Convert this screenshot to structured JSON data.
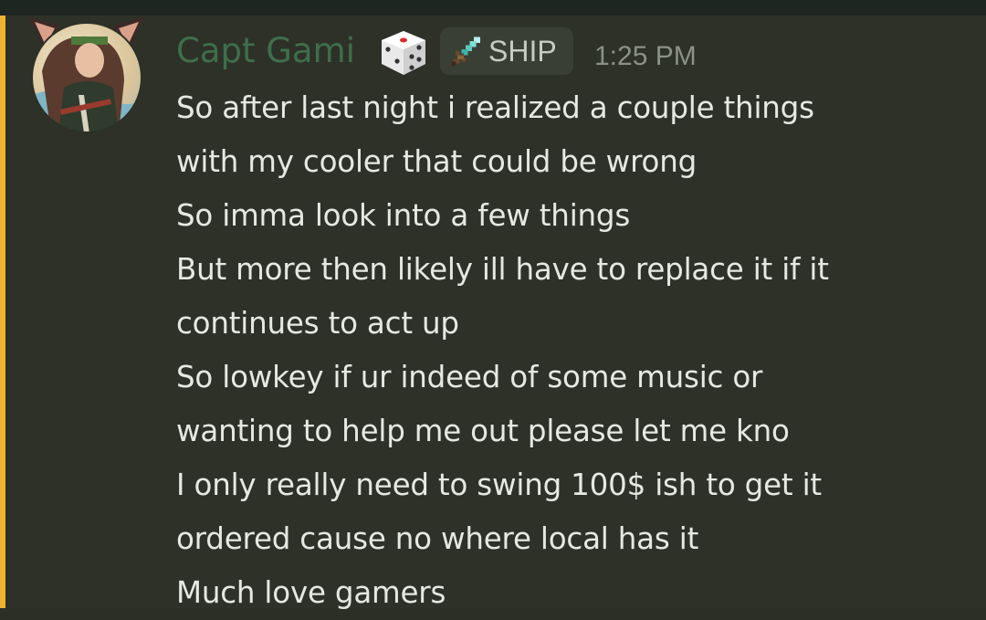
{
  "message": {
    "author": {
      "name": "Capt Gami",
      "name_color": "#3f6e4b",
      "avatar": "avatar-image",
      "status_icon": "dice-icon"
    },
    "role_badge": {
      "icon": "sword-icon",
      "label": "SHIP"
    },
    "timestamp": "1:25 PM",
    "accent_color": "#f0b232",
    "lines": [
      "So after last night i realized a couple things",
      "with my cooler that could be wrong",
      "So imma look into a few things",
      "But more then likely ill have to replace it if it",
      "continues to act up",
      "So lowkey if ur indeed of some music or",
      "wanting to help me out please let me kno",
      "I only really need to swing 100$ ish to get it",
      "ordered cause no where local has it",
      "Much love gamers"
    ]
  }
}
